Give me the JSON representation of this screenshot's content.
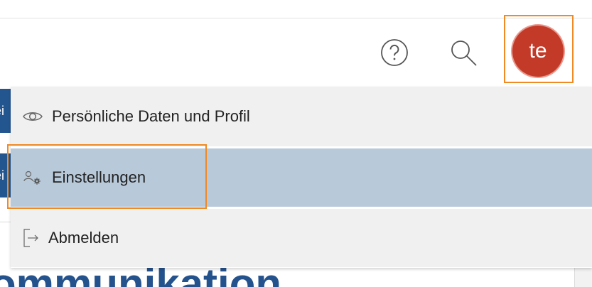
{
  "header": {
    "help_icon": "help-circle-icon",
    "search_icon": "search-icon",
    "avatar_initials": "te"
  },
  "background": {
    "tab1_text": "ei",
    "tab2_text": "ei",
    "heading_text": "ommunikation"
  },
  "menu": {
    "items": [
      {
        "label": "Persönliche Daten und Profil",
        "icon": "eye-icon"
      },
      {
        "label": "Einstellungen",
        "icon": "user-settings-icon",
        "selected": true
      },
      {
        "label": "Abmelden",
        "icon": "logout-icon"
      }
    ]
  },
  "colors": {
    "accent_focus": "#f08a24",
    "avatar_bg": "#c33a28",
    "selected_bg": "#b8c9da",
    "brand_blue": "#24528c"
  }
}
